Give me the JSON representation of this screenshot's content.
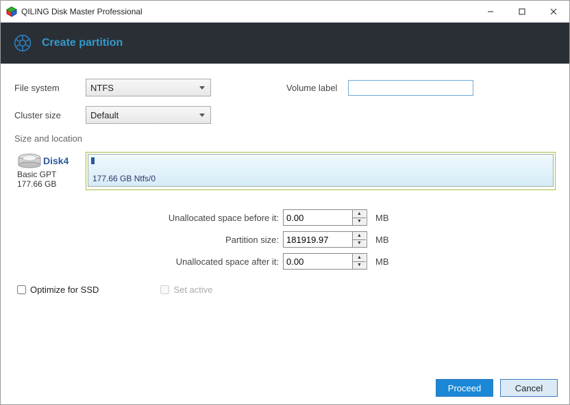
{
  "titlebar": {
    "title": "QILING Disk Master Professional"
  },
  "header": {
    "title": "Create partition"
  },
  "labels": {
    "file_system": "File system",
    "cluster_size": "Cluster size",
    "volume_label": "Volume label",
    "size_location": "Size and location",
    "unalloc_before": "Unallocated space before it:",
    "partition_size": "Partition size:",
    "unalloc_after": "Unallocated space after it:",
    "mb": "MB",
    "optimize_ssd": "Optimize for SSD",
    "set_active": "Set active"
  },
  "values": {
    "file_system": "NTFS",
    "cluster_size": "Default",
    "volume_label": "",
    "unalloc_before": "0.00",
    "partition_size": "181919.97",
    "unalloc_after": "0.00"
  },
  "disk": {
    "name": "Disk4",
    "type": "Basic GPT",
    "size": "177.66 GB",
    "part_label": "177.66 GB Ntfs/0"
  },
  "buttons": {
    "proceed": "Proceed",
    "cancel": "Cancel"
  }
}
